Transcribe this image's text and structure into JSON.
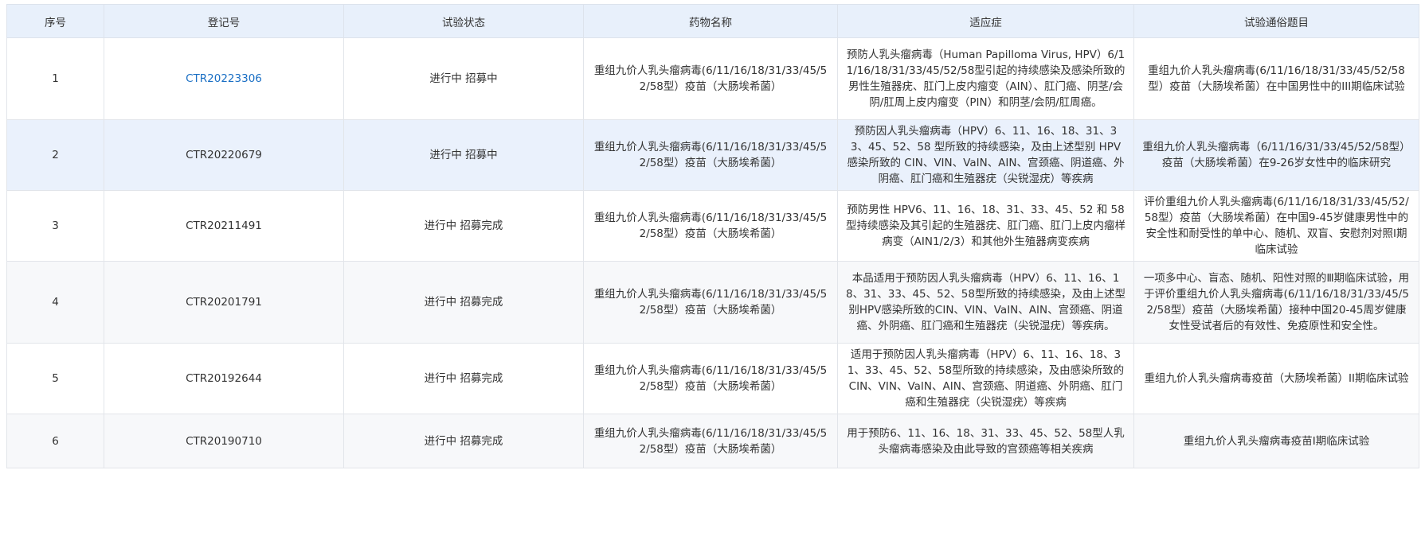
{
  "table": {
    "headers": [
      "序号",
      "登记号",
      "试验状态",
      "药物名称",
      "适应症",
      "试验通俗题目"
    ],
    "rows": [
      {
        "index": "1",
        "reg_no": "CTR20223306",
        "reg_no_is_link": true,
        "status": "进行中 招募中",
        "drug": "重组九价人乳头瘤病毒(6/11/16/18/31/33/45/52/58型）疫苗（大肠埃希菌）",
        "indication": "预防人乳头瘤病毒（Human Papilloma Virus, HPV）6/11/16/18/31/33/45/52/58型引起的持续感染及感染所致的男性生殖器疣、肛门上皮内瘤变（AIN）、肛门癌、阴茎/会阴/肛周上皮内瘤变（PIN）和阴茎/会阴/肛周癌。",
        "title": "重组九价人乳头瘤病毒(6/11/16/18/31/33/45/52/58型）疫苗（大肠埃希菌）在中国男性中的III期临床试验"
      },
      {
        "index": "2",
        "reg_no": "CTR20220679",
        "reg_no_is_link": false,
        "status": "进行中 招募中",
        "drug": "重组九价人乳头瘤病毒(6/11/16/18/31/33/45/52/58型）疫苗（大肠埃希菌）",
        "indication": "预防因人乳头瘤病毒（HPV）6、11、16、18、31、33、45、52、58 型所致的持续感染，及由上述型别 HPV 感染所致的 CIN、VIN、VaIN、AIN、宫颈癌、阴道癌、外阴癌、肛门癌和生殖器疣（尖锐湿疣）等疾病",
        "title": "重组九价人乳头瘤病毒（6/11/16/31/33/45/52/58型）疫苗（大肠埃希菌）在9-26岁女性中的临床研究"
      },
      {
        "index": "3",
        "reg_no": "CTR20211491",
        "reg_no_is_link": false,
        "status": "进行中 招募完成",
        "drug": "重组九价人乳头瘤病毒(6/11/16/18/31/33/45/52/58型）疫苗（大肠埃希菌）",
        "indication": "预防男性 HPV6、11、16、18、31、33、45、52 和 58 型持续感染及其引起的生殖器疣、肛门癌、肛门上皮内瘤样病变（AIN1/2/3）和其他外生殖器病变疾病",
        "title": "评价重组九价人乳头瘤病毒(6/11/16/18/31/33/45/52/58型）疫苗（大肠埃希菌）在中国9-45岁健康男性中的安全性和耐受性的单中心、随机、双盲、安慰剂对照I期临床试验"
      },
      {
        "index": "4",
        "reg_no": "CTR20201791",
        "reg_no_is_link": false,
        "status": "进行中 招募完成",
        "drug": "重组九价人乳头瘤病毒(6/11/16/18/31/33/45/52/58型）疫苗（大肠埃希菌）",
        "indication": "本品适用于预防因人乳头瘤病毒（HPV）6、11、16、18、31、33、45、52、58型所致的持续感染，及由上述型别HPV感染所致的CIN、VIN、VaIN、AIN、宫颈癌、阴道癌、外阴癌、肛门癌和生殖器疣（尖锐湿疣）等疾病。",
        "title": "一项多中心、盲态、随机、阳性对照的Ⅲ期临床试验，用于评价重组九价人乳头瘤病毒(6/11/16/18/31/33/45/52/58型）疫苗（大肠埃希菌）接种中国20-45周岁健康女性受试者后的有效性、免疫原性和安全性。"
      },
      {
        "index": "5",
        "reg_no": "CTR20192644",
        "reg_no_is_link": false,
        "status": "进行中 招募完成",
        "drug": "重组九价人乳头瘤病毒(6/11/16/18/31/33/45/52/58型）疫苗（大肠埃希菌）",
        "indication": "适用于预防因人乳头瘤病毒（HPV）6、11、16、18、31、33、45、52、58型所致的持续感染，及由感染所致的CIN、VIN、VaIN、AIN、宫颈癌、阴道癌、外阴癌、肛门癌和生殖器疣（尖锐湿疣）等疾病",
        "title": "重组九价人乳头瘤病毒疫苗（大肠埃希菌）II期临床试验"
      },
      {
        "index": "6",
        "reg_no": "CTR20190710",
        "reg_no_is_link": false,
        "status": "进行中 招募完成",
        "drug": "重组九价人乳头瘤病毒(6/11/16/18/31/33/45/52/58型）疫苗（大肠埃希菌）",
        "indication": "用于预防6、11、16、18、31、33、45、52、58型人乳头瘤病毒感染及由此导致的宫颈癌等相关疾病",
        "title": "重组九价人乳头瘤病毒疫苗I期临床试验"
      }
    ]
  },
  "colors": {
    "header_bg": "#e8f0fb",
    "highlight_row_bg": "#eaf1fc",
    "alt_row_bg": "#f7f8fa",
    "link": "#1a6fc4",
    "text": "#333333"
  }
}
